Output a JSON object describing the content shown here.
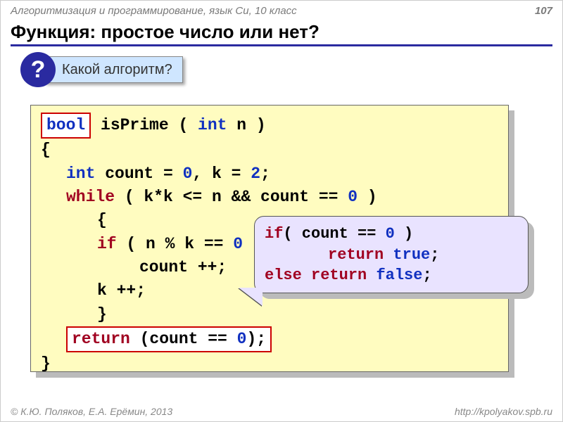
{
  "header": {
    "course": "Алгоритмизация и программирование, язык Си, 10 класс",
    "page": "107"
  },
  "title": "Функция: простое число или нет?",
  "question": {
    "badge": "?",
    "text": "Какой алгоритм?"
  },
  "code": {
    "l1_bool": "bool",
    "l1_rest_a": " isPrime ( ",
    "l1_int": "int",
    "l1_rest_b": " n )",
    "l2": "{",
    "l3_int": "int",
    "l3_rest": " count = ",
    "l3_zero": "0",
    "l3_mid": ",  k = ",
    "l3_two": "2",
    "l3_end": ";",
    "l4_while": "while",
    "l4_rest_a": " ( k*k  <= n && count == ",
    "l4_zero": "0",
    "l4_rest_b": " )",
    "l5": "{",
    "l6_if": "if",
    "l6_rest_a": " ( n % k == ",
    "l6_zero": "0",
    "l6_rest_b": " ) ",
    "l7": "count ++;",
    "l8": "k ++;",
    "l9": "}",
    "l10_return": "return",
    "l10_rest_a": " (count == ",
    "l10_zero": "0",
    "l10_rest_b": ");",
    "l11": "}"
  },
  "callout": {
    "c1_if": "if",
    "c1_rest_a": "( count == ",
    "c1_zero": "0",
    "c1_rest_b": " )",
    "c2_return": "return",
    "c2_true": "true",
    "c2_semi": ";",
    "c3_else": "else",
    "c3_return": "return",
    "c3_false": "false",
    "c3_semi": ";"
  },
  "footer": {
    "authors": "К.Ю. Поляков, Е.А. Ерёмин, 2013",
    "url": "http://kpolyakov.spb.ru"
  }
}
